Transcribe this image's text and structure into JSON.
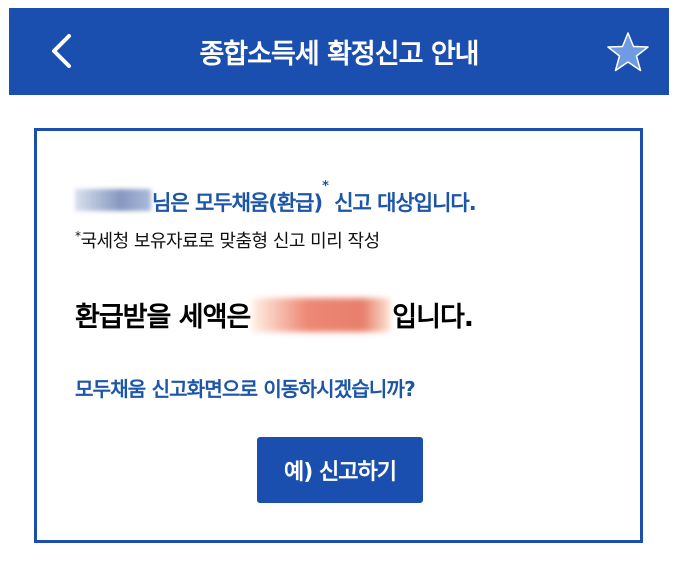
{
  "header": {
    "title": "종합소득세 확정신고 안내",
    "back_icon": "chevron-left-icon",
    "favorite_icon": "star-icon"
  },
  "notice": {
    "eligible_suffix": "님은 모두채움(환급)",
    "eligible_mark": "*",
    "eligible_tail": " 신고 대상입니다.",
    "footnote_mark": "*",
    "footnote_text": "국세청 보유자료로 맞춤형 신고 미리 작성",
    "refund_prefix": "환급받을 세액은",
    "refund_suffix": "입니다.",
    "question": "모두채움 신고화면으로 이동하시겠습니까?",
    "confirm_label": "예) 신고하기"
  },
  "colors": {
    "primary": "#1a4fb0",
    "accent_text": "#1d56a8"
  }
}
